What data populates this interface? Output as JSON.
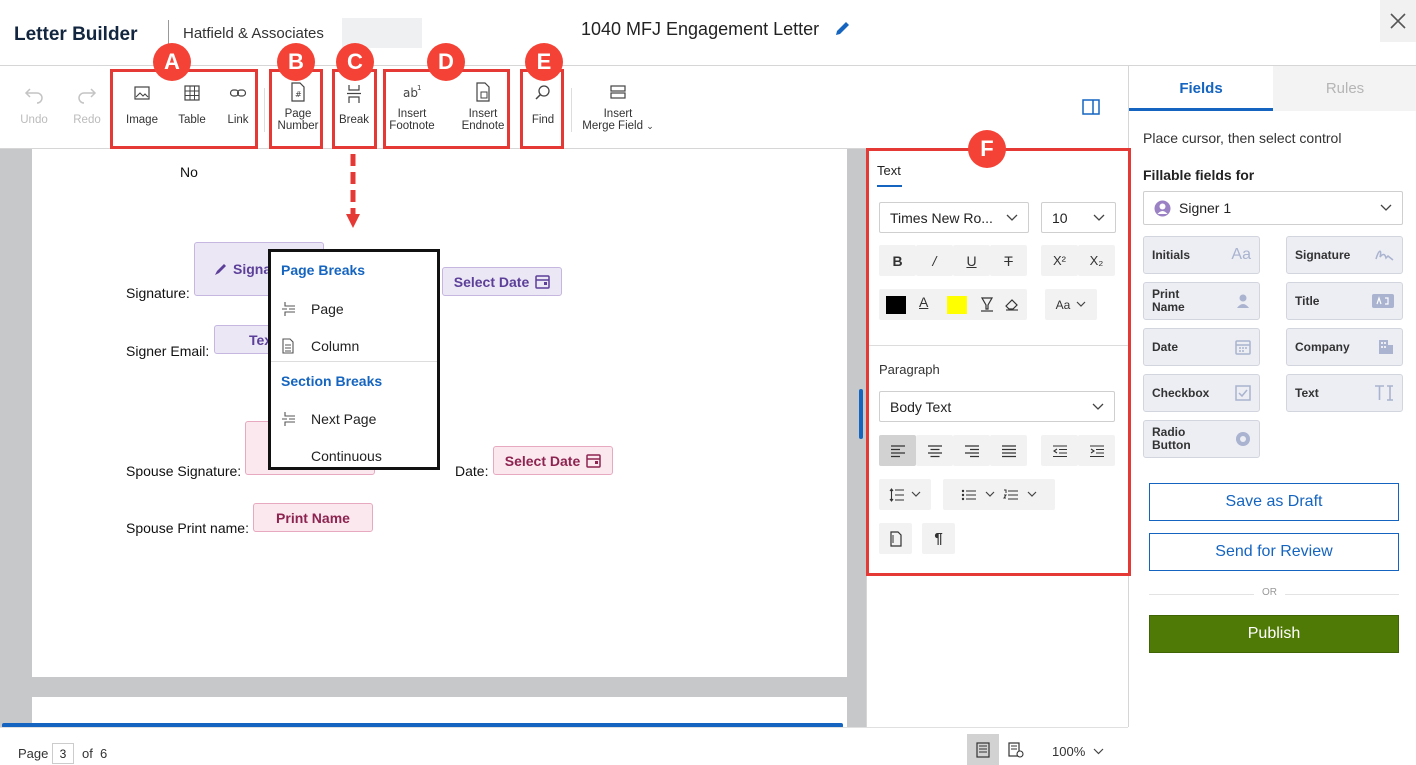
{
  "header": {
    "brand": "Letter Builder",
    "firm": "Hatfield & Associates",
    "doc_title": "1040 MFJ Engagement Letter"
  },
  "toolbar": {
    "undo": "Undo",
    "redo": "Redo",
    "image": "Image",
    "table": "Table",
    "link": "Link",
    "page_number_1": "Page",
    "page_number_2": "Number",
    "break": "Break",
    "footnote_1": "Insert",
    "footnote_2": "Footnote",
    "endnote_1": "Insert",
    "endnote_2": "Endnote",
    "find": "Find",
    "merge_1": "Insert",
    "merge_2": "Merge Field"
  },
  "document": {
    "no_text": "No",
    "signature_label": "Signature:",
    "signature_field": "Signa",
    "select_date_1": "Select Date",
    "signer_email_label": "Signer Email:",
    "email_field": "Tex",
    "spouse_signature_label": "Spouse Signature:",
    "date_label": "Date:",
    "select_date_2": "Select Date",
    "spouse_print_label": "Spouse Print name:",
    "print_name_field": "Print Name"
  },
  "break_menu": {
    "page_breaks_heading": "Page Breaks",
    "page": "Page",
    "column": "Column",
    "section_breaks_heading": "Section Breaks",
    "next_page": "Next Page",
    "continuous": "Continuous"
  },
  "format_panel": {
    "text_tab": "Text",
    "font": "Times New Ro...",
    "size": "10",
    "paragraph_heading": "Paragraph",
    "style": "Body Text",
    "case_btn": "Aa",
    "text_color": "#000000",
    "highlight_color": "#ffff00"
  },
  "right_panel": {
    "tab_fields": "Fields",
    "tab_rules": "Rules",
    "hint": "Place cursor, then select control",
    "fillable_heading": "Fillable fields for",
    "signer": "Signer 1",
    "controls": {
      "initials": "Initials",
      "signature": "Signature",
      "print_name_1": "Print",
      "print_name_2": "Name",
      "title": "Title",
      "date": "Date",
      "company": "Company",
      "checkbox": "Checkbox",
      "text": "Text",
      "radio_1": "Radio",
      "radio_2": "Button"
    },
    "save_draft": "Save as Draft",
    "send_review": "Send for Review",
    "or": "OR",
    "publish": "Publish"
  },
  "status_bar": {
    "page_label": "Page",
    "page_current": "3",
    "of_label": "of",
    "page_total": "6",
    "zoom": "100%"
  },
  "callouts": {
    "a": "A",
    "b": "B",
    "c": "C",
    "d": "D",
    "e": "E",
    "f": "F"
  },
  "colors": {
    "accent": "#1565c0",
    "publish": "#4f7a05",
    "callout": "#f44336"
  }
}
